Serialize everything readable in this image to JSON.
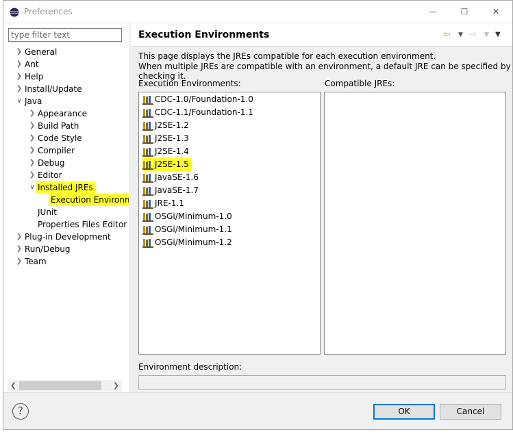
{
  "window": {
    "title": "Preferences"
  },
  "filter": {
    "placeholder": "type filter text"
  },
  "tree": {
    "general": "General",
    "ant": "Ant",
    "help": "Help",
    "install_update": "Install/Update",
    "java": "Java",
    "appearance": "Appearance",
    "build_path": "Build Path",
    "code_style": "Code Style",
    "compiler": "Compiler",
    "debug": "Debug",
    "editor": "Editor",
    "installed_jres": "Installed JREs",
    "execution_environments": "Execution Environm",
    "junit": "JUnit",
    "properties_files_editor": "Properties Files Editor",
    "plugin_development": "Plug-in Development",
    "run_debug": "Run/Debug",
    "team": "Team"
  },
  "page": {
    "title": "Execution Environments",
    "description_1": "This page displays the JREs compatible for each execution environment.",
    "description_2": "When multiple JREs are compatible with an environment, a default JRE can be specified by checking it.",
    "ee_label": "Execution Environments:",
    "compatible_label": "Compatible JREs:",
    "env_description_label": "Environment description:",
    "environments": [
      "CDC-1.0/Foundation-1.0",
      "CDC-1.1/Foundation-1.1",
      "J2SE-1.2",
      "J2SE-1.3",
      "J2SE-1.4",
      "J2SE-1.5",
      "JavaSE-1.6",
      "JavaSE-1.7",
      "JRE-1.1",
      "OSGi/Minimum-1.0",
      "OSGi/Minimum-1.1",
      "OSGi/Minimum-1.2"
    ],
    "highlighted_environment": "J2SE-1.5"
  },
  "buttons": {
    "ok": "OK",
    "cancel": "Cancel"
  },
  "icons": {
    "app": "eclipse-icon",
    "help": "help-icon",
    "back": "back-arrow-icon",
    "forward": "forward-arrow-icon",
    "menu": "view-menu-icon",
    "environment": "jre-library-icon"
  },
  "colors": {
    "highlight": "#ffff2e",
    "default_button_border": "#0078d7"
  }
}
